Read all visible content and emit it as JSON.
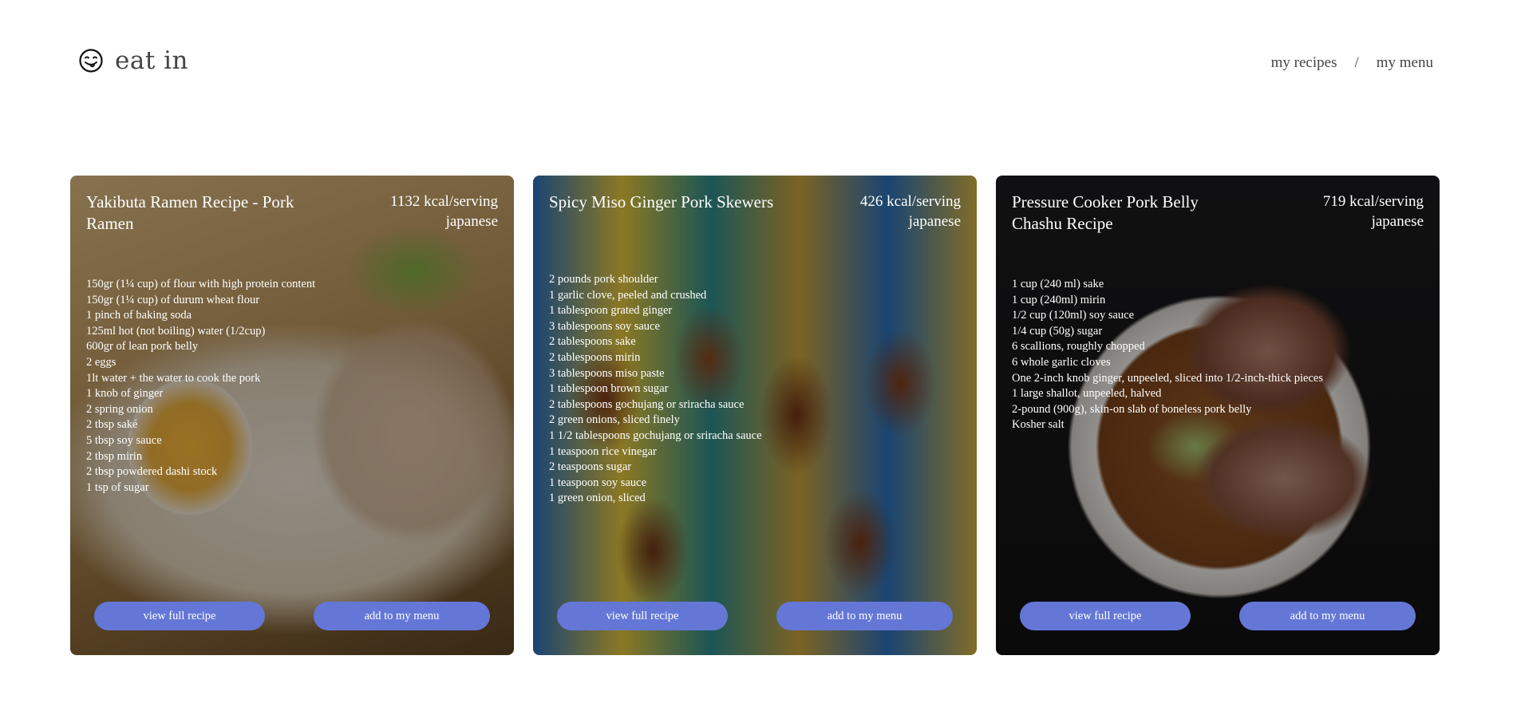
{
  "header": {
    "logo_icon": "smiley-tongue-icon",
    "logo_text": "eat in",
    "nav": {
      "my_recipes": "my recipes",
      "separator": "/",
      "my_menu": "my menu"
    }
  },
  "cards": [
    {
      "title": "Yakibuta Ramen Recipe - Pork Ramen",
      "kcal": "1132 kcal/serving",
      "cuisine": "japanese",
      "ingredients": [
        "150gr (1¼ cup) of flour with high protein content",
        "150gr (1¼ cup) of durum wheat flour",
        "1 pinch of baking soda",
        "125ml hot (not boiling) water (1/2cup)",
        "600gr of lean pork belly",
        "2 eggs",
        "1lt water + the water to cook the pork",
        "1 knob of ginger",
        "2 spring onion",
        "2 tbsp saké",
        "5 tbsp soy sauce",
        "2 tbsp mirin",
        "2 tbsp powdered dashi stock",
        "1 tsp of sugar"
      ],
      "view_label": "view full recipe",
      "add_label": "add to my menu"
    },
    {
      "title": "Spicy Miso Ginger Pork Skewers",
      "kcal": "426 kcal/serving",
      "cuisine": "japanese",
      "ingredients": [
        "2 pounds pork shoulder",
        "1 garlic clove, peeled and crushed",
        "1 tablespoon grated ginger",
        "3 tablespoons soy sauce",
        "2 tablespoons sake",
        "2 tablespoons mirin",
        "3 tablespoons miso paste",
        "1 tablespoon brown sugar",
        "2 tablespoons gochujang or sriracha sauce",
        "2 green onions, sliced finely",
        "1 1/2 tablespoons gochujang or sriracha sauce",
        "1 teaspoon rice vinegar",
        "2 teaspoons sugar",
        "1 teaspoon soy sauce",
        "1 green onion, sliced"
      ],
      "view_label": "view full recipe",
      "add_label": "add to my menu"
    },
    {
      "title": "Pressure Cooker Pork Belly Chashu Recipe",
      "kcal": "719 kcal/serving",
      "cuisine": "japanese",
      "ingredients": [
        "1 cup (240 ml) sake",
        "1 cup (240ml) mirin",
        "1/2 cup (120ml) soy sauce",
        "1/4 cup (50g) sugar",
        "6 scallions, roughly chopped",
        "6 whole garlic cloves",
        "One 2-inch knob ginger, unpeeled, sliced into 1/2-inch-thick pieces",
        "1 large shallot, unpeeled, halved",
        "2-pound (900g), skin-on slab of boneless pork belly",
        "Kosher salt"
      ],
      "view_label": "view full recipe",
      "add_label": "add to my menu"
    }
  ],
  "colors": {
    "button": "#6477d6",
    "text_on_card": "#ffffff",
    "header_text": "#444444"
  }
}
